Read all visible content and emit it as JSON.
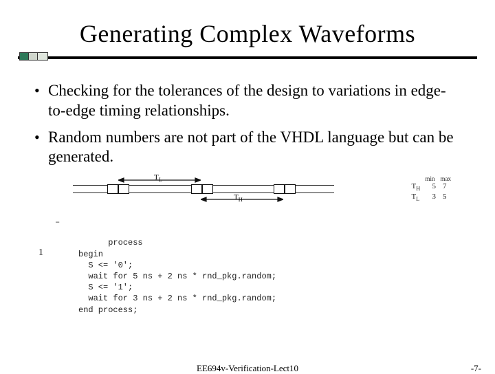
{
  "title": "Generating Complex Waveforms",
  "bullets": [
    "Checking for the tolerances of the design to variations in edge-to-edge timing relationships.",
    "Random numbers are not part of the VHDL language but can be generated."
  ],
  "timing": {
    "tl_label": "T",
    "tl_sub": "L",
    "th_label": "T",
    "th_sub": "H",
    "table": {
      "header": [
        "min",
        "max"
      ],
      "rows": [
        {
          "label": "T_H",
          "min": "5",
          "max": "7"
        },
        {
          "label": "T_L",
          "min": "3",
          "max": "5"
        }
      ]
    }
  },
  "code": {
    "l1": "process",
    "l2": "begin",
    "l3": "  S <= '0';",
    "l4": "  wait for 5 ns + 2 ns * rnd_pkg.random;",
    "l5": "  S <= '1';",
    "l6": "  wait for 3 ns + 2 ns * rnd_pkg.random;",
    "l7": "end process;"
  },
  "footer": {
    "center": "EE694v-Verification-Lect10",
    "right": "-7-"
  }
}
